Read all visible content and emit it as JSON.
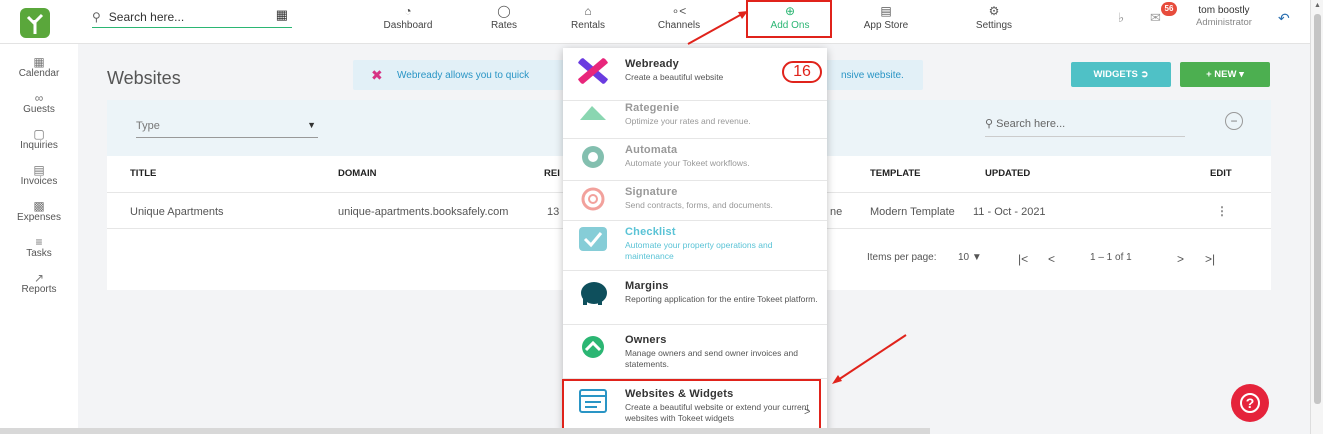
{
  "topbar": {
    "search_placeholder": "Search here...",
    "nav": [
      {
        "label": "Dashboard",
        "icon": "speedometer-icon"
      },
      {
        "label": "Rates",
        "icon": "money-icon"
      },
      {
        "label": "Rentals",
        "icon": "home-icon"
      },
      {
        "label": "Channels",
        "icon": "share-icon"
      },
      {
        "label": "Add Ons",
        "icon": "plus-circle-icon"
      },
      {
        "label": "App Store",
        "icon": "store-icon"
      },
      {
        "label": "Settings",
        "icon": "gear-icon"
      }
    ],
    "notification_count": "56",
    "user_name": "tom boostly",
    "user_role": "Administrator"
  },
  "sidebar": {
    "items": [
      {
        "label": "Calendar",
        "icon": "calendar-icon"
      },
      {
        "label": "Guests",
        "icon": "guests-icon"
      },
      {
        "label": "Inquiries",
        "icon": "inquiries-icon"
      },
      {
        "label": "Invoices",
        "icon": "invoice-icon"
      },
      {
        "label": "Expenses",
        "icon": "briefcase-icon"
      },
      {
        "label": "Tasks",
        "icon": "tasks-icon"
      },
      {
        "label": "Reports",
        "icon": "chart-icon"
      }
    ]
  },
  "page": {
    "title": "Websites",
    "banner_left": "Webready allows you to quick",
    "banner_right": "nsive website.",
    "widgets_button": "WIDGETS",
    "new_button": "NEW",
    "type_filter": "Type",
    "table_search_placeholder": "Search here..."
  },
  "table": {
    "headers": {
      "title": "TITLE",
      "domain": "DOMAIN",
      "ren": "REI",
      "template": "TEMPLATE",
      "updated": "UPDATED",
      "edit": "EDIT"
    },
    "row": {
      "title": "Unique Apartments",
      "domain": "unique-apartments.booksafely.com",
      "ren": "13",
      "tz": "ne",
      "template": "Modern Template",
      "updated": "11 - Oct - 2021"
    },
    "pager": {
      "label": "Items per page:",
      "per_page": "10",
      "range": "1 – 1 of 1"
    }
  },
  "addons_menu": [
    {
      "title": "Webready",
      "desc": "Create a beautiful website"
    },
    {
      "title": "Rategenie",
      "desc": "Optimize your rates and revenue."
    },
    {
      "title": "Automata",
      "desc": "Automate your Tokeet workflows."
    },
    {
      "title": "Signature",
      "desc": "Send contracts, forms, and documents."
    },
    {
      "title": "Checklist",
      "desc": "Automate your property operations and maintenance"
    },
    {
      "title": "Margins",
      "desc": "Reporting application for the entire Tokeet platform."
    },
    {
      "title": "Owners",
      "desc": "Manage owners and send owner invoices and statements."
    },
    {
      "title": "Websites & Widgets",
      "desc": "Create a beautiful website or extend your current websites with Tokeet widgets"
    }
  ],
  "annotation_number": "16",
  "colors": {
    "accent": "#2bb673",
    "annotation": "#e0231b",
    "help": "#e5233b"
  }
}
